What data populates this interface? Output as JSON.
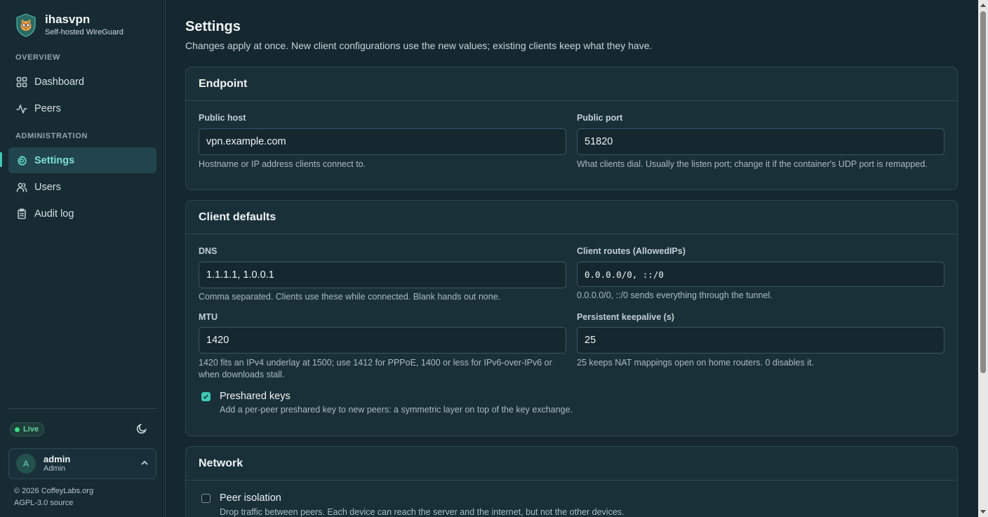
{
  "brand": {
    "name": "ihasvpn",
    "subtitle": "Self-hosted WireGuard",
    "logo": "shield-cat-logo"
  },
  "sidebar": {
    "sections": [
      "OVERVIEW",
      "ADMINISTRATION"
    ],
    "items": [
      {
        "label": "Dashboard",
        "icon": "dashboard-icon"
      },
      {
        "label": "Peers",
        "icon": "activity-icon"
      },
      {
        "label": "Settings",
        "icon": "gear-icon",
        "active": true
      },
      {
        "label": "Users",
        "icon": "users-icon"
      },
      {
        "label": "Audit log",
        "icon": "clipboard-icon"
      }
    ],
    "status": "Live",
    "user": {
      "initial": "A",
      "name": "admin",
      "role": "Admin"
    },
    "footer": {
      "copyright": "© 2026 CoffeyLabs.org",
      "license": "AGPL-3.0 source"
    }
  },
  "page": {
    "title": "Settings",
    "description": "Changes apply at once. New client configurations use the new values; existing clients keep what they have."
  },
  "endpoint": {
    "title": "Endpoint",
    "public_host": {
      "label": "Public host",
      "value": "vpn.example.com",
      "hint": "Hostname or IP address clients connect to."
    },
    "public_port": {
      "label": "Public port",
      "value": "51820",
      "hint": "What clients dial. Usually the listen port; change it if the container's UDP port is remapped."
    }
  },
  "client_defaults": {
    "title": "Client defaults",
    "dns": {
      "label": "DNS",
      "value": "1.1.1.1, 1.0.0.1",
      "hint": "Comma separated. Clients use these while connected. Blank hands out none."
    },
    "routes": {
      "label": "Client routes (AllowedIPs)",
      "value": "0.0.0.0/0, ::/0",
      "hint": "0.0.0.0/0, ::/0 sends everything through the tunnel."
    },
    "mtu": {
      "label": "MTU",
      "value": "1420",
      "hint_line1": "1420 fits an IPv4 underlay at 1500; use 1412 for PPPoE, 1400 or less for IPv6-over-IPv6 or",
      "hint_line2": "when downloads stall."
    },
    "keepalive": {
      "label": "Persistent keepalive (s)",
      "value": "25",
      "hint": "25 keeps NAT mappings open on home routers. 0 disables it."
    },
    "preshared": {
      "label": "Preshared keys",
      "checked": true,
      "desc": "Add a per-peer preshared key to new peers: a symmetric layer on top of the key exchange."
    }
  },
  "network": {
    "title": "Network",
    "isolation": {
      "label": "Peer isolation",
      "checked": false,
      "desc": "Drop traffic between peers. Each device can reach the server and the internet, but not the other devices."
    }
  },
  "colors": {
    "accent": "#3fc9b7",
    "background": "#152830",
    "card": "#1a3039"
  }
}
